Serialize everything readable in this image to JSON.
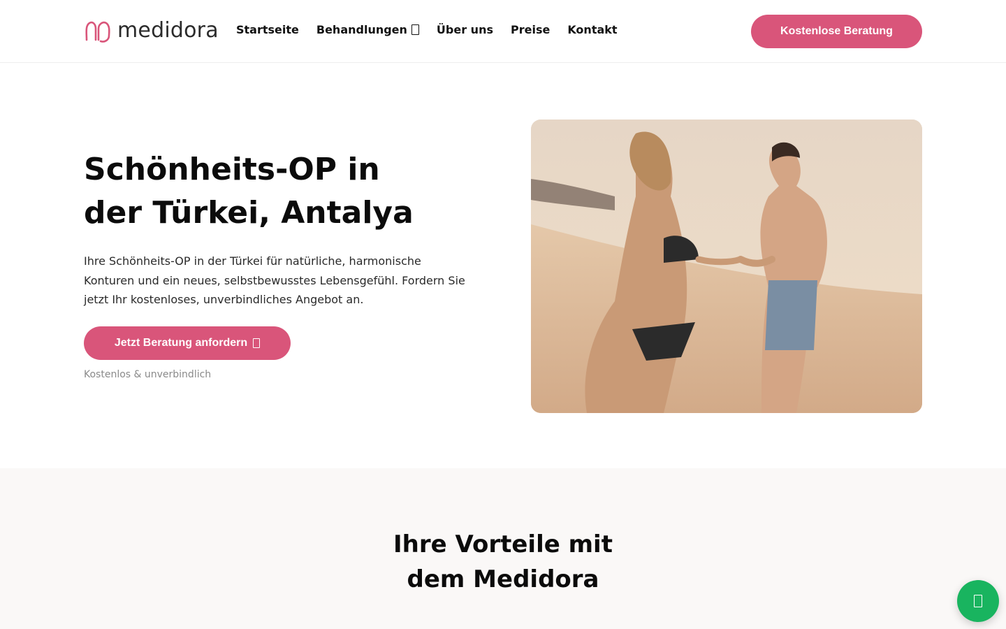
{
  "brand": {
    "name": "medidora",
    "accent_color": "#d9557a",
    "logo_icon": "heart-logo-icon"
  },
  "nav": {
    "items": [
      {
        "label": "Startseite"
      },
      {
        "label": "Behandlungen",
        "icon": "chevron-down-icon"
      },
      {
        "label": "Über uns"
      },
      {
        "label": "Preise"
      },
      {
        "label": "Kontakt"
      }
    ],
    "cta_label": "Kostenlose Beratung"
  },
  "hero": {
    "title_line1": "Schönheits-OP in",
    "title_line2": "der Türkei, Antalya",
    "text": "Ihre Schönheits-OP in der Türkei für natürliche, harmonische Konturen und ein neues, selbstbewusstes Lebensgefühl. Fordern Sie jetzt Ihr kostenloses, unverbindliches Angebot an.",
    "cta_label": "Jetzt Beratung anfordern",
    "cta_icon": "arrow-right-icon",
    "note": "Kostenlos & unverbindlich"
  },
  "vorteile": {
    "title_line1": "Ihre Vorteile mit",
    "title_line2": "dem Medidora"
  },
  "floating": {
    "icon": "whatsapp-icon",
    "color": "#19b45f"
  }
}
